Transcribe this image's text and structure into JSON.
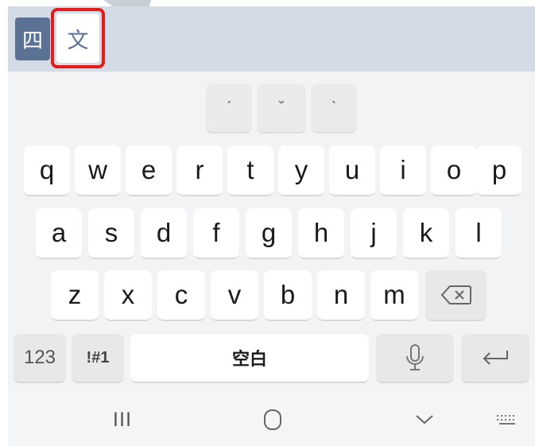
{
  "toolbar": {
    "mode_sijiao": "四",
    "mode_wen": "文"
  },
  "tone_keys": [
    "ˊ",
    "ˇ",
    "ˋ"
  ],
  "rows": [
    [
      "q",
      "w",
      "e",
      "r",
      "t",
      "y",
      "u",
      "i",
      "o",
      "p"
    ],
    [
      "a",
      "s",
      "d",
      "f",
      "g",
      "h",
      "j",
      "k",
      "l"
    ],
    [
      "z",
      "x",
      "c",
      "v",
      "b",
      "n",
      "m"
    ]
  ],
  "bottom_row": {
    "numbers_label": "123",
    "symbols_label": "!#1",
    "space_label": "空白"
  },
  "nav": {
    "recents": "III",
    "home": "◯",
    "back": "⌵",
    "keyboard": "⠿"
  },
  "colors": {
    "toolbar_bg": "#d3dbe7",
    "active_mode_bg": "#5b7294",
    "highlight_border": "#e31b1b",
    "keyboard_bg": "#f2f3f5",
    "key_bg": "#ffffff",
    "func_key_bg": "#e6e8ea"
  }
}
